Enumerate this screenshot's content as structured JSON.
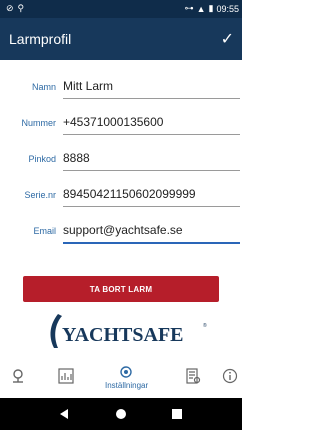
{
  "status": {
    "time": "09:55"
  },
  "appbar": {
    "title": "Larmprofil"
  },
  "fields": [
    {
      "label": "Namn",
      "value": "Mitt Larm"
    },
    {
      "label": "Nummer",
      "value": "+45371000135600"
    },
    {
      "label": "Pinkod",
      "value": "8888"
    },
    {
      "label": "Serie.nr",
      "value": "89450421150602099999"
    },
    {
      "label": "Email",
      "value": "support@yachtsafe.se"
    }
  ],
  "actions": {
    "delete_label": "TA BORT LARM"
  },
  "logo": {
    "text": "YACHTSAFE",
    "reg": "®"
  },
  "bottom_nav": {
    "settings_label": "Inställningar"
  },
  "colors": {
    "appbar": "#17385b",
    "delete": "#b61e2a",
    "label": "#2e6aa4"
  }
}
